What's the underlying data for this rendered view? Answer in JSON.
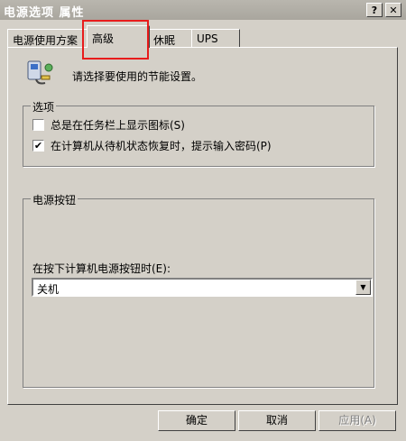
{
  "window": {
    "title": "电源选项 属性",
    "help_label": "?",
    "close_label": "✕"
  },
  "tabs": [
    {
      "label": "电源使用方案"
    },
    {
      "label": "高级",
      "active": true
    },
    {
      "label": "休眠"
    },
    {
      "label": "UPS"
    }
  ],
  "advanced": {
    "intro_text": "请选择要使用的节能设置。",
    "options_group": {
      "label": "选项",
      "items": [
        {
          "label": "总是在任务栏上显示图标(S)",
          "checked": false
        },
        {
          "label": "在计算机从待机状态恢复时，提示输入密码(P)",
          "checked": true
        }
      ]
    },
    "power_buttons_group": {
      "label": "电源按钮",
      "select_label": "在按下计算机电源按钮时(E):",
      "select_value": "关机"
    }
  },
  "footer": {
    "ok_label": "确定",
    "cancel_label": "取消",
    "apply_label": "应用(A)"
  },
  "colors": {
    "highlight": "#e81c1c",
    "dialog_bg": "#d4d0c8"
  }
}
